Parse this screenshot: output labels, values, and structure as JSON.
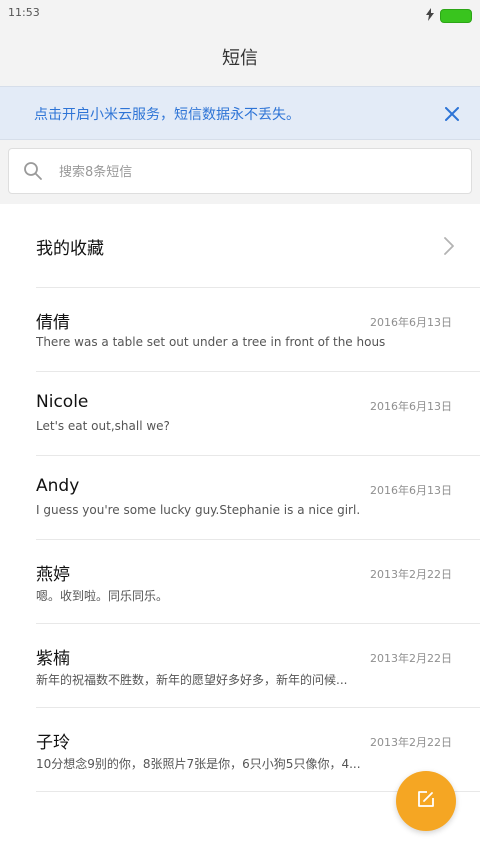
{
  "status": {
    "time": "11:53"
  },
  "title": "短信",
  "banner": {
    "text": "点击开启小米云服务，短信数据永不丢失。"
  },
  "search": {
    "placeholder": "搜索8条短信"
  },
  "favorites": {
    "label": "我的收藏"
  },
  "conversations": [
    {
      "name": "倩倩",
      "date": "2016年6月13日",
      "snippet": "There was a table set out under a tree in front of the hous"
    },
    {
      "name": "Nicole",
      "date": "2016年6月13日",
      "snippet": "Let's eat out,shall we?"
    },
    {
      "name": "Andy",
      "date": "2016年6月13日",
      "snippet": "I guess you're some lucky guy.Stephanie is a nice girl."
    },
    {
      "name": "燕婷",
      "date": "2013年2月22日",
      "snippet": "嗯。收到啦。同乐同乐。"
    },
    {
      "name": "紫楠",
      "date": "2013年2月22日",
      "snippet": "新年的祝福数不胜数，新年的愿望好多好多，新年的问候..."
    },
    {
      "name": "子玲",
      "date": "2013年2月22日",
      "snippet": "10分想念9别的你，8张照片7张是你，6只小狗5只像你，4..."
    }
  ],
  "colors": {
    "accent": "#2e74d6",
    "fab": "#f5a623",
    "battery": "#39c41e"
  },
  "icons": {
    "charging": "lightning-icon",
    "battery": "battery-icon",
    "close": "close-icon",
    "search": "search-icon",
    "chevron": "chevron-right-icon",
    "compose": "compose-icon"
  }
}
